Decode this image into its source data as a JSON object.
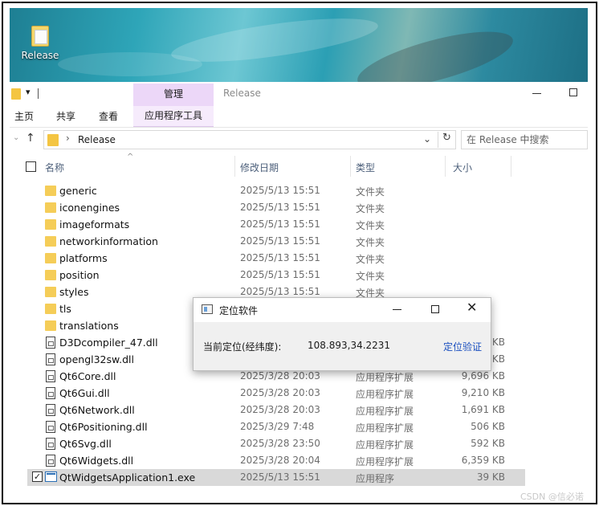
{
  "desktop": {
    "icon_label": "Release"
  },
  "ribbon": {
    "contextual_tab": "管理",
    "window_title": "Release",
    "tabs": [
      "主页",
      "共享",
      "查看"
    ],
    "contextual_subtab": "应用程序工具"
  },
  "address": {
    "path": "Release",
    "search_placeholder": "在 Release 中搜索"
  },
  "columns": {
    "name": "名称",
    "date": "修改日期",
    "type": "类型",
    "size": "大小"
  },
  "files": [
    {
      "name": "generic",
      "date": "2025/5/13 15:51",
      "type": "文件夹",
      "size": "",
      "kind": "folder"
    },
    {
      "name": "iconengines",
      "date": "2025/5/13 15:51",
      "type": "文件夹",
      "size": "",
      "kind": "folder"
    },
    {
      "name": "imageformats",
      "date": "2025/5/13 15:51",
      "type": "文件夹",
      "size": "",
      "kind": "folder"
    },
    {
      "name": "networkinformation",
      "date": "2025/5/13 15:51",
      "type": "文件夹",
      "size": "",
      "kind": "folder"
    },
    {
      "name": "platforms",
      "date": "2025/5/13 15:51",
      "type": "文件夹",
      "size": "",
      "kind": "folder"
    },
    {
      "name": "position",
      "date": "2025/5/13 15:51",
      "type": "文件夹",
      "size": "",
      "kind": "folder"
    },
    {
      "name": "styles",
      "date": "2025/5/13 15:51",
      "type": "文件夹",
      "size": "",
      "kind": "folder"
    },
    {
      "name": "tls",
      "date": "",
      "type": "",
      "size": "",
      "kind": "folder"
    },
    {
      "name": "translations",
      "date": "",
      "type": "",
      "size": "",
      "kind": "folder"
    },
    {
      "name": "D3Dcompiler_47.dll",
      "date": "",
      "type": "",
      "size": "KB",
      "kind": "dll"
    },
    {
      "name": "opengl32sw.dll",
      "date": "",
      "type": "",
      "size": "KB",
      "kind": "dll"
    },
    {
      "name": "Qt6Core.dll",
      "date": "2025/3/28 20:03",
      "type": "应用程序扩展",
      "size": "9,696 KB",
      "kind": "dll"
    },
    {
      "name": "Qt6Gui.dll",
      "date": "2025/3/28 20:03",
      "type": "应用程序扩展",
      "size": "9,210 KB",
      "kind": "dll"
    },
    {
      "name": "Qt6Network.dll",
      "date": "2025/3/28 20:03",
      "type": "应用程序扩展",
      "size": "1,691 KB",
      "kind": "dll"
    },
    {
      "name": "Qt6Positioning.dll",
      "date": "2025/3/29 7:48",
      "type": "应用程序扩展",
      "size": "506 KB",
      "kind": "dll"
    },
    {
      "name": "Qt6Svg.dll",
      "date": "2025/3/28 23:50",
      "type": "应用程序扩展",
      "size": "592 KB",
      "kind": "dll"
    },
    {
      "name": "Qt6Widgets.dll",
      "date": "2025/3/28 20:04",
      "type": "应用程序扩展",
      "size": "6,359 KB",
      "kind": "dll"
    },
    {
      "name": "QtWidgetsApplication1.exe",
      "date": "2025/5/13 15:51",
      "type": "应用程序",
      "size": "39 KB",
      "kind": "exe",
      "selected": true
    }
  ],
  "dialog": {
    "title": "定位软件",
    "label": "当前定位(经纬度):",
    "value": "108.893,34.2231",
    "link": "定位验证"
  },
  "watermark": "CSDN @信必诺"
}
